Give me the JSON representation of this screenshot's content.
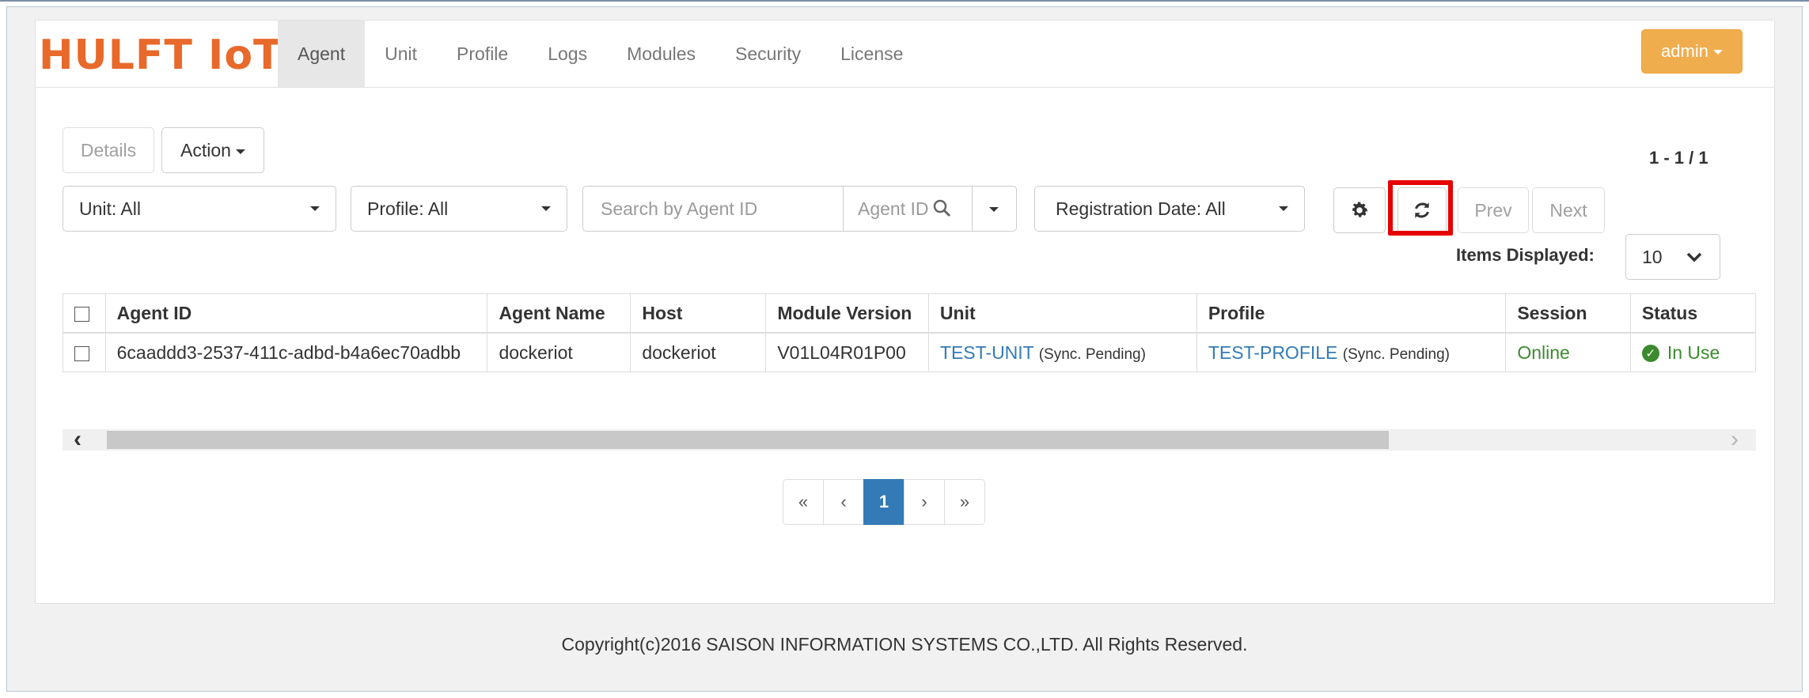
{
  "brand": {
    "logo_text": "HULFT IoT",
    "accent": "#e8692a"
  },
  "nav": {
    "items": [
      {
        "label": "Agent",
        "active": true
      },
      {
        "label": "Unit"
      },
      {
        "label": "Profile"
      },
      {
        "label": "Logs"
      },
      {
        "label": "Modules"
      },
      {
        "label": "Security"
      },
      {
        "label": "License"
      }
    ],
    "user_label": "admin"
  },
  "toolbar": {
    "details_label": "Details",
    "action_label": "Action",
    "unit_filter": "Unit: All",
    "profile_filter": "Profile: All",
    "search_placeholder": "Search by Agent ID",
    "search_field": "Agent ID",
    "registration_filter": "Registration Date:  All",
    "prev_label": "Prev",
    "next_label": "Next",
    "result_count": "1 - 1 / 1",
    "items_displayed_label": "Items Displayed:",
    "items_displayed_value": "10",
    "settings_icon": "gear-icon",
    "refresh_icon": "refresh-icon"
  },
  "table": {
    "columns": [
      "Agent ID",
      "Agent Name",
      "Host",
      "Module Version",
      "Unit",
      "Profile",
      "Session",
      "Status"
    ],
    "rows": [
      {
        "agent_id": "6caaddd3-2537-411c-adbd-b4a6ec70adbb",
        "agent_name": "dockeriot",
        "host": "dockeriot",
        "module_version": "V01L04R01P00",
        "unit": "TEST-UNIT",
        "unit_note": "(Sync. Pending)",
        "profile": "TEST-PROFILE",
        "profile_note": "(Sync. Pending)",
        "session": "Online",
        "status": "In Use"
      }
    ]
  },
  "pagination": {
    "first": "«",
    "prev": "‹",
    "current": "1",
    "next": "›",
    "last": "»"
  },
  "footer": {
    "copyright": "Copyright(c)2016 SAISON INFORMATION SYSTEMS CO.,LTD. All Rights Reserved."
  }
}
